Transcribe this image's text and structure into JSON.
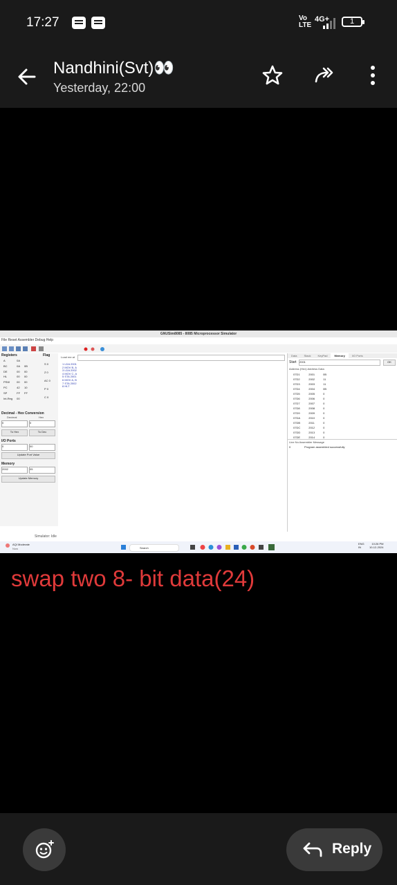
{
  "status_bar": {
    "time": "17:27",
    "volte": "Vo\nLTE",
    "network": "4G+",
    "battery": "1"
  },
  "header": {
    "contact_name": "Nandhini(Svt)👀",
    "timestamp": "Yesterday, 22:00"
  },
  "screenshot": {
    "window_title": "GNUSim8085 - 8085 Microprocessor Simulator",
    "menu": "File  Reset  Assembler  Debug  Help",
    "left_panel": {
      "registers_label": "Registers",
      "flag_label": "Flag",
      "registers": [
        [
          "A",
          "0A",
          ""
        ],
        [
          "BC",
          "0A",
          "0B"
        ],
        [
          "DE",
          "00",
          "00"
        ],
        [
          "HL",
          "00",
          "00"
        ],
        [
          "PSW",
          "00",
          "00"
        ],
        [
          "PC",
          "42",
          "10"
        ],
        [
          "SP",
          "FF",
          "FF"
        ],
        [
          "Int-Reg",
          "00",
          ""
        ]
      ],
      "flags": [
        "S  0",
        "Z  0",
        "AC 0",
        "P  0",
        "C  0"
      ],
      "conversion_label": "Decimal - Hex Conversion",
      "decimal_label": "Decimal",
      "hex_label": "Hex",
      "decimal_value": "0",
      "hex_value": "0",
      "to_hex_button": "To Hex",
      "to_dec_button": "To Dec",
      "io_ports_label": "I/O Ports",
      "io_port_value": "0",
      "io_data_value": "00",
      "update_port_button": "Update Port Value",
      "memory_label": "Memory",
      "memory_addr": "2002",
      "memory_value": "05",
      "update_memory_button": "Update Memory"
    },
    "code": {
      "load_label": "Load me at",
      "lines": [
        "1   LDA 2001",
        "2   MOV B, A",
        "3   LDA 2002",
        "4   MOV C, A",
        "5   STA 2001",
        "6   MOV A, B",
        "7   STA 2002",
        "8   HLT"
      ]
    },
    "right_panel": {
      "tabs": [
        "Data",
        "Stack",
        "KeyPad",
        "Memory",
        "I/O Ports"
      ],
      "start_label": "Start",
      "start_value": "2001",
      "ok_button": "OK",
      "columns": [
        "Address (Hex)",
        "Address",
        "Data"
      ],
      "rows": [
        [
          "07D1",
          "2001",
          "0B"
        ],
        [
          "07D2",
          "2002",
          "11"
        ],
        [
          "07D3",
          "2003",
          "11"
        ],
        [
          "07D4",
          "2004",
          "0B"
        ],
        [
          "07D5",
          "2005",
          "0"
        ],
        [
          "07D6",
          "2006",
          "0"
        ],
        [
          "07D7",
          "2007",
          "0"
        ],
        [
          "07D8",
          "2008",
          "0"
        ],
        [
          "07D9",
          "2009",
          "0"
        ],
        [
          "07DA",
          "2010",
          "0"
        ],
        [
          "07DB",
          "2011",
          "0"
        ],
        [
          "07DC",
          "2012",
          "0"
        ],
        [
          "07DD",
          "2013",
          "0"
        ],
        [
          "07DE",
          "2014",
          "0"
        ]
      ],
      "message_headers": [
        "Line No",
        "Assembler Message"
      ],
      "message_line": "0",
      "message_text": "Program assembled successfully"
    },
    "status_text": "Simulator: Idle",
    "taskbar": {
      "weather": "AQI Moderate",
      "weather_sub": "Now",
      "search": "Search",
      "lang": "ENG\nIN",
      "clock": "10:26 PM\n10-12-2024"
    }
  },
  "caption": "swap two 8- bit data(24)",
  "reply_label": "Reply"
}
